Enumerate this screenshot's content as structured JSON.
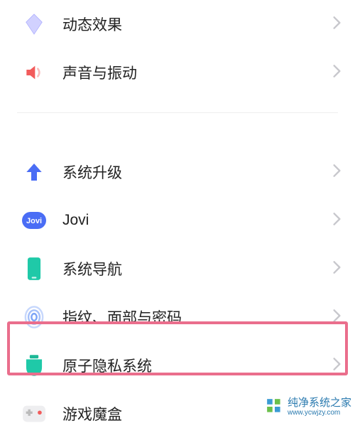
{
  "section1": {
    "items": [
      {
        "label": "动态效果",
        "icon": "diamond-icon"
      },
      {
        "label": "声音与振动",
        "icon": "speaker-icon"
      }
    ]
  },
  "section2": {
    "items": [
      {
        "label": "系统升级",
        "icon": "upgrade-arrow-icon"
      },
      {
        "label": "Jovi",
        "icon": "jovi-icon"
      },
      {
        "label": "系统导航",
        "icon": "phone-icon"
      },
      {
        "label": "指纹、面部与密码",
        "icon": "fingerprint-icon"
      },
      {
        "label": "原子隐私系统",
        "icon": "privacy-shield-icon"
      },
      {
        "label": "游戏魔盒",
        "icon": "gamepad-icon"
      }
    ]
  },
  "watermark": {
    "title": "纯净系统之家",
    "url": "www.ycwjzy.com"
  }
}
